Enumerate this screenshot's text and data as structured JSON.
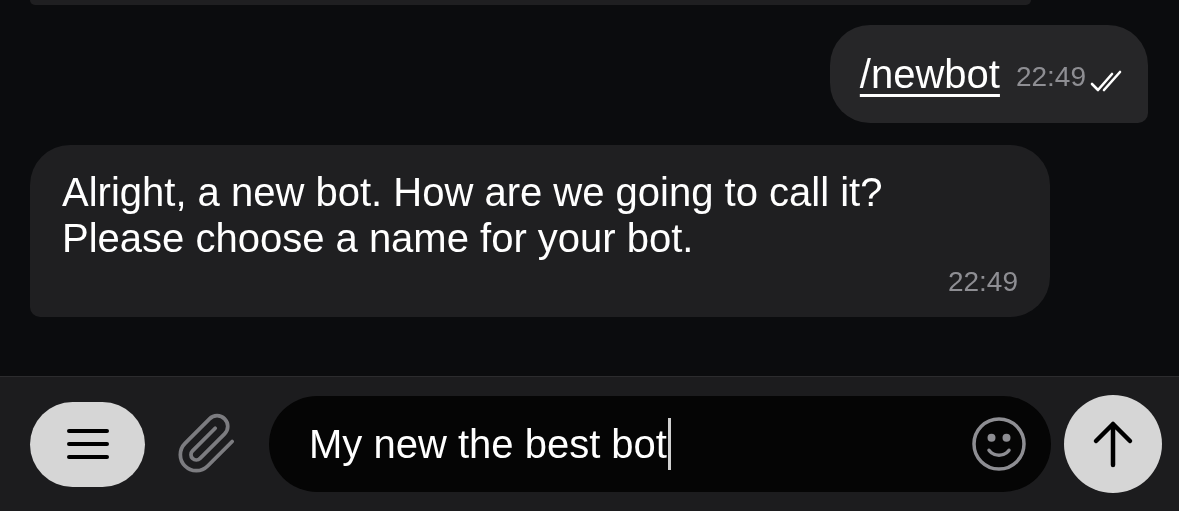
{
  "messages": [
    {
      "kind": "command",
      "outgoing": true,
      "text": "/newbot",
      "time": "22:49",
      "read": true
    },
    {
      "kind": "text",
      "outgoing": false,
      "text": "Alright, a new bot. How are we going to call it? Please choose a name for your bot.",
      "time": "22:49",
      "read": false
    }
  ],
  "composer": {
    "value": "My new the best bot"
  }
}
